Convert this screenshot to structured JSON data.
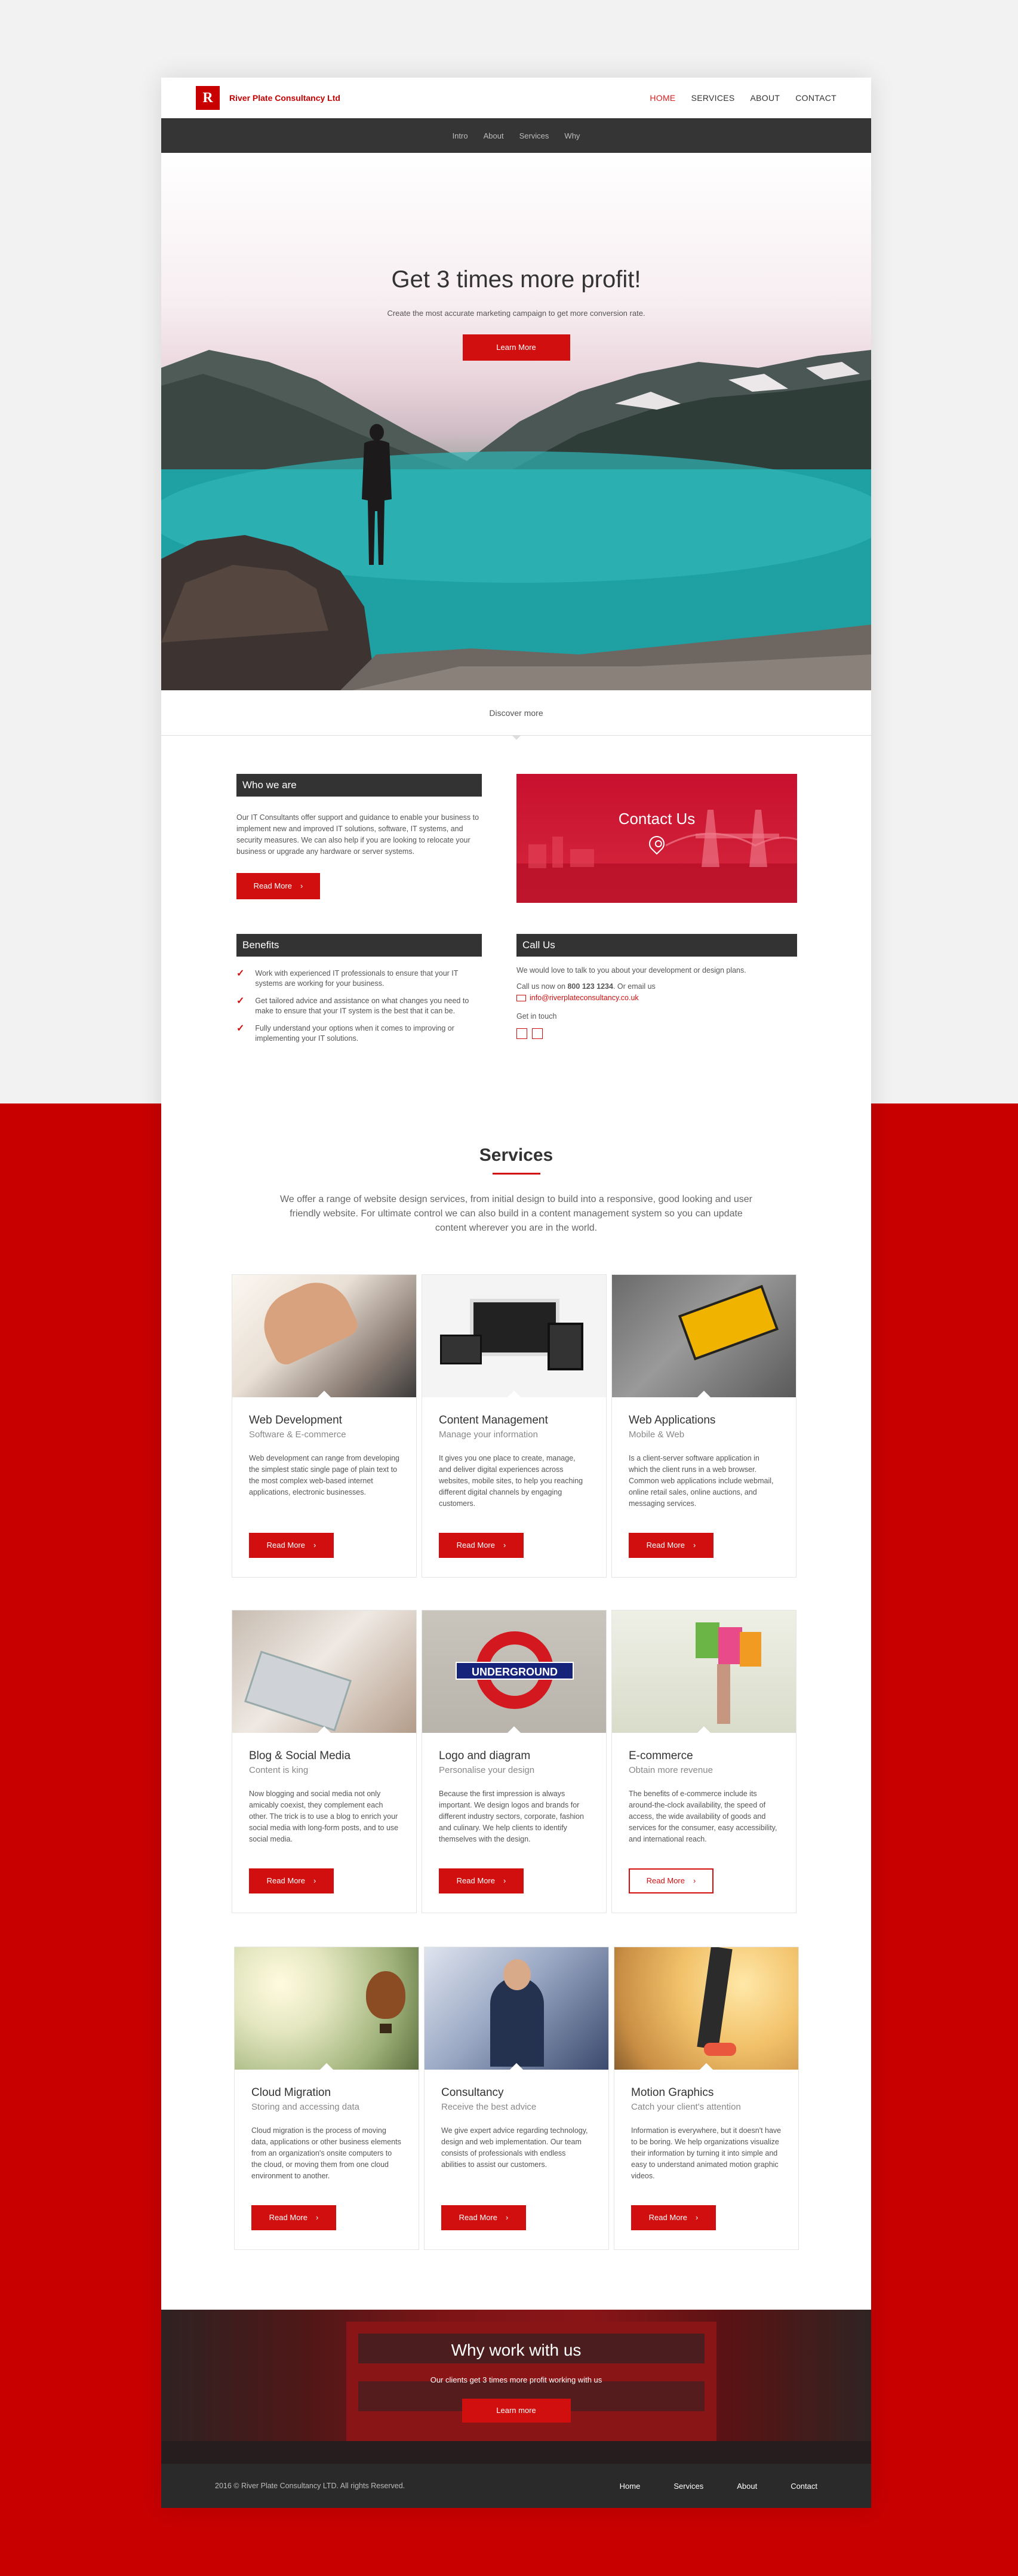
{
  "brand": {
    "logo_letter": "R",
    "name": "River Plate Consultancy Ltd"
  },
  "main_nav": [
    "HOME",
    "SERVICES",
    "ABOUT",
    "CONTACT"
  ],
  "sub_nav": [
    "Intro",
    "About",
    "Services",
    "Why"
  ],
  "hero": {
    "title": "Get 3 times more profit!",
    "subtitle": "Create the most accurate marketing campaign to get more conversion rate.",
    "button": "Learn More"
  },
  "discover": "Discover more",
  "about": {
    "who_title": "Who we are",
    "who_text": "Our IT Consultants offer support and guidance to enable your business to implement new and improved IT solutions, software, IT systems, and security measures. We can also help if you are looking to relocate your business or upgrade any hardware or server systems.",
    "read_more": "Read More",
    "benefits_title": "Benefits",
    "benefits": [
      "Work with experienced IT professionals to ensure that your IT systems are working for your business.",
      "Get tailored advice and assistance on what changes you need to make to ensure that your IT system is the best that it can be.",
      "Fully understand your options when it comes to improving or implementing your IT solutions."
    ],
    "contact_card_title": "Contact Us",
    "call_title": "Call Us",
    "call_text": "We would love to talk to you about your development or design plans.",
    "call_prefix": "Call us now on",
    "phone": "800 123 1234",
    "call_suffix": ". Or email us",
    "email": "info@riverplateconsultancy.co.uk",
    "get_in_touch": "Get in touch"
  },
  "services": {
    "title": "Services",
    "intro": "We offer a range of website design services, from initial design to build into a responsive, good looking and user friendly website. For ultimate control we can also build in a content management system so you can update content wherever you are in the world.",
    "read_more": "Read More",
    "cards": [
      {
        "title": "Web Development",
        "subtitle": "Software & E-commerce",
        "text": "Web development can range from developing the simplest static single page of plain text to the most complex web-based internet applications, electronic businesses."
      },
      {
        "title": "Content Management",
        "subtitle": "Manage your information",
        "text": "It gives you one place to create, manage, and deliver digital experiences across websites, mobile sites, to help you reaching different digital channels by engaging customers."
      },
      {
        "title": "Web Applications",
        "subtitle": "Mobile & Web",
        "text": "Is a client-server software application in which the client runs in a web browser. Common web applications include webmail, online retail sales, online auctions, and messaging services."
      },
      {
        "title": "Blog & Social Media",
        "subtitle": "Content is king",
        "text": "Now blogging and social media not only amicably coexist, they complement each other. The trick is to use a blog to enrich your social media with long-form posts, and to use social media."
      },
      {
        "title": "Logo and diagram",
        "subtitle": "Personalise your design",
        "text": "Because the first impression is always important. We design logos and brands for different industry sectors, corporate, fashion and culinary. We help clients to identify themselves with the design.",
        "image_label": "UNDERGROUND"
      },
      {
        "title": "E-commerce",
        "subtitle": "Obtain more revenue",
        "text": "The benefits of e-commerce include its around-the-clock availability, the speed of access, the wide availability of goods and services for the consumer, easy accessibility, and international reach."
      },
      {
        "title": "Cloud Migration",
        "subtitle": "Storing and accessing data",
        "text": "Cloud migration is the process of moving data, applications or other business elements from an organization's onsite computers to the cloud, or moving them from one cloud environment to another."
      },
      {
        "title": "Consultancy",
        "subtitle": "Receive the best advice",
        "text": "We give expert advice regarding technology, design and web implementation. Our team consists of professionals with endless abilities to assist our customers."
      },
      {
        "title": "Motion Graphics",
        "subtitle": "Catch your client's attention",
        "text": "Information is everywhere, but it doesn't have to be boring. We help organizations visualize their information by turning it into simple and easy to understand animated motion graphic videos."
      }
    ]
  },
  "why": {
    "title": "Why work with us",
    "subtitle": "Our clients get 3 times more profit working with us",
    "button": "Learn more"
  },
  "footer": {
    "copyright": "2016 © River Plate Consultancy LTD. All rights Reserved.",
    "nav": [
      "Home",
      "Services",
      "About",
      "Contact"
    ]
  },
  "colors": {
    "accent": "#d10f0f",
    "dark": "#333333",
    "red_background": "#c80000"
  }
}
